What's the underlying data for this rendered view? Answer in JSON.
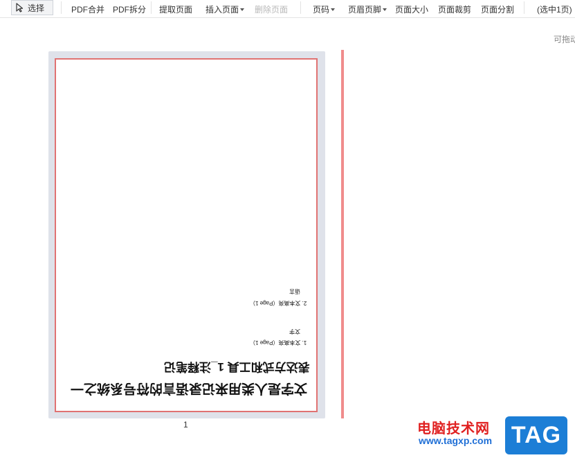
{
  "toolbar": {
    "select_label": "选择",
    "items": {
      "pdf_merge": "PDF合并",
      "pdf_split": "PDF拆分",
      "extract_page": "提取页面",
      "insert_page": "插入页面",
      "delete_page": "删除页面",
      "page_number": "页码",
      "header_footer": "页眉页脚",
      "page_size": "页面大小",
      "page_crop": "页面裁剪",
      "page_split": "页面分割",
      "selected_count": "(选中1页)"
    },
    "drag_hint": "可拖动"
  },
  "page_thumbnail": {
    "page_number": "1",
    "selected": true,
    "content": {
      "title_line1": "文字是人类用来记录语言的符号系统之一",
      "title_line2": "表达方式和工具 1_注释笔记",
      "note1_label": "1. 文本高亮（Page 1）",
      "note1_text": "文字",
      "note2_label": "2. 文本高亮（Page 1）",
      "note2_text": "语言"
    }
  },
  "watermark": {
    "site_name": "电脑技术网",
    "site_url": "www.tagxp.com",
    "logo_text": "TAG"
  },
  "colors": {
    "selection_border": "#e07272",
    "drop_indicator": "#f08c8c",
    "thumb_shadow": "#dfe2ea"
  }
}
